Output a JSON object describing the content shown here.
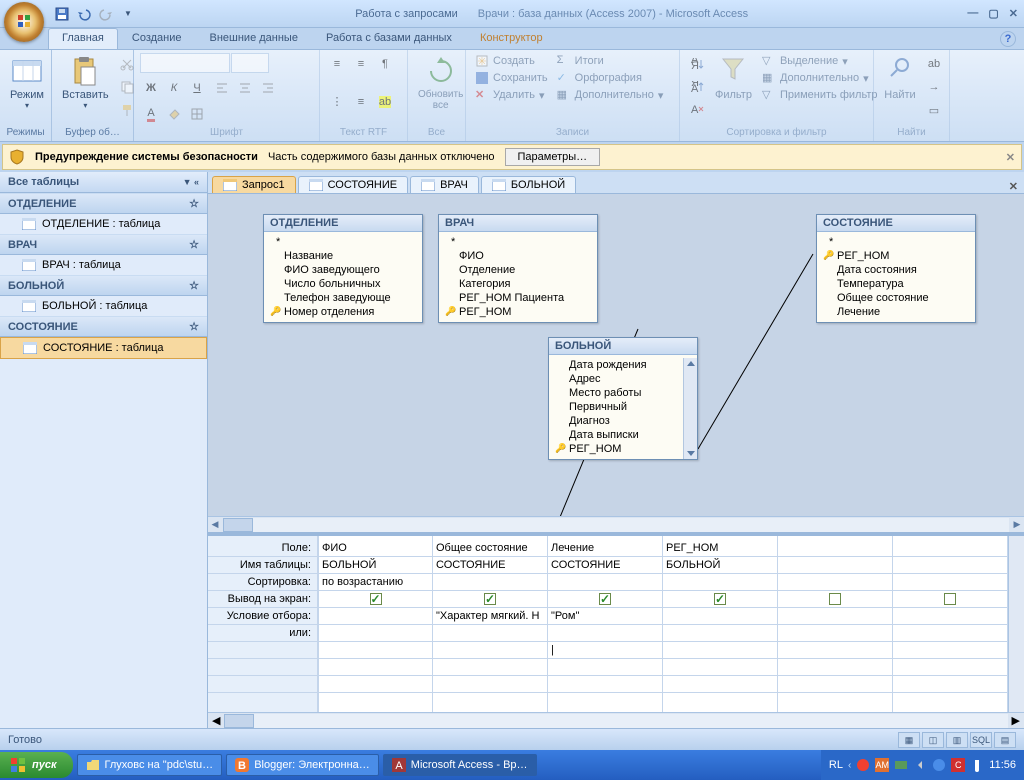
{
  "title": {
    "context": "Работа с запросами",
    "main": "Врачи : база данных (Access 2007) - Microsoft Access"
  },
  "tabs": {
    "home": "Главная",
    "create": "Создание",
    "external": "Внешние данные",
    "dbtools": "Работа с базами данных",
    "designer": "Конструктор"
  },
  "ribbon": {
    "view": "Режим",
    "views_g": "Режимы",
    "paste": "Вставить",
    "clipboard_g": "Буфер об…",
    "font_g": "Шрифт",
    "rtf_g": "Текст RTF",
    "refresh": "Обновить все",
    "refresh_g": "Все",
    "new": "Создать",
    "save": "Сохранить",
    "delete": "Удалить",
    "totals": "Итоги",
    "spelling": "Орфография",
    "more": "Дополнительно",
    "records_g": "Записи",
    "filter": "Фильтр",
    "selection": "Выделение",
    "advanced": "Дополнительно",
    "toggle": "Применить фильтр",
    "sort_g": "Сортировка и фильтр",
    "find": "Найти",
    "find_g": "Найти"
  },
  "security": {
    "title": "Предупреждение системы безопасности",
    "msg": "Часть содержимого базы данных отключено",
    "btn": "Параметры…"
  },
  "nav": {
    "header": "Все таблицы",
    "groups": [
      {
        "name": "ОТДЕЛЕНИЕ",
        "items": [
          "ОТДЕЛЕНИЕ : таблица"
        ]
      },
      {
        "name": "ВРАЧ",
        "items": [
          "ВРАЧ : таблица"
        ]
      },
      {
        "name": "БОЛЬНОЙ",
        "items": [
          "БОЛЬНОЙ : таблица"
        ]
      },
      {
        "name": "СОСТОЯНИЕ",
        "items": [
          "СОСТОЯНИЕ : таблица"
        ]
      }
    ]
  },
  "docTabs": {
    "t0": "Запрос1",
    "t1": "СОСТОЯНИЕ",
    "t2": "ВРАЧ",
    "t3": "БОЛЬНОЙ"
  },
  "diagram": {
    "box1": {
      "title": "ОТДЕЛЕНИЕ",
      "f0": "*",
      "f1": "Название",
      "f2": "ФИО заведующего",
      "f3": "Число больничных",
      "f4": "Телефон заведующе",
      "f5": "Номер отделения"
    },
    "box2": {
      "title": "ВРАЧ",
      "f0": "*",
      "f1": "ФИО",
      "f2": "Отделение",
      "f3": "Категория",
      "f4": "РЕГ_НОМ Пациента",
      "f5": "РЕГ_НОМ"
    },
    "box3": {
      "title": "БОЛЬНОЙ",
      "f1": "Дата рождения",
      "f2": "Адрес",
      "f3": "Место работы",
      "f4": "Первичный",
      "f5": "Диагноз",
      "f6": "Дата выписки",
      "f7": "РЕГ_НОМ"
    },
    "box4": {
      "title": "СОСТОЯНИЕ",
      "f0": "*",
      "f1": "РЕГ_НОМ",
      "f2": "Дата состояния",
      "f3": "Температура",
      "f4": "Общее состояние",
      "f5": "Лечение"
    }
  },
  "grid": {
    "labels": {
      "field": "Поле:",
      "table": "Имя таблицы:",
      "sort": "Сортировка:",
      "show": "Вывод на экран:",
      "criteria": "Условие отбора:",
      "or": "или:"
    },
    "c1": {
      "field": "ФИО",
      "table": "БОЛЬНОЙ",
      "sort": "по возрастанию",
      "crit": ""
    },
    "c2": {
      "field": "Общее состояние",
      "table": "СОСТОЯНИЕ",
      "sort": "",
      "crit": "\"Характер мягкий. Н"
    },
    "c3": {
      "field": "Лечение",
      "table": "СОСТОЯНИЕ",
      "sort": "",
      "crit": "\"Ром\""
    },
    "c4": {
      "field": "РЕГ_НОМ",
      "table": "БОЛЬНОЙ",
      "sort": "",
      "crit": ""
    }
  },
  "status": {
    "ready": "Готово",
    "sql": "SQL"
  },
  "taskbar": {
    "start": "пуск",
    "t1": "Глуховс на \"pdc\\stu…",
    "t2": "Blogger: Электронна…",
    "t3": "Microsoft Access - Вр…",
    "lang": "RL",
    "am": "AM",
    "c": "C",
    "time": "11:56"
  }
}
